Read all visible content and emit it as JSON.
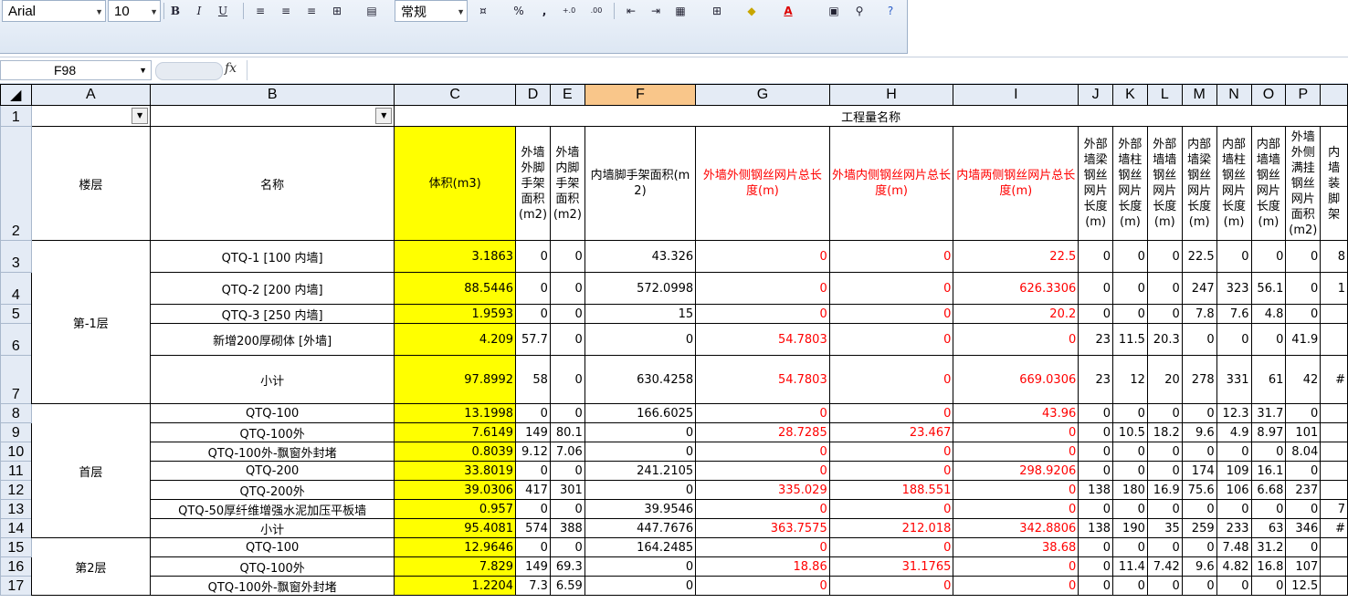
{
  "toolbar": {
    "font_name": "Arial",
    "font_size": "10",
    "bold_label": "B",
    "italic_label": "I",
    "underline_label": "U",
    "number_format": "常规",
    "percent_label": "%",
    "comma_label": ",",
    "inc_decimal_label": "+.0 .00",
    "dec_decimal_label": ".00 →.0"
  },
  "formula_bar": {
    "name_box": "F98",
    "fx_label": "fx",
    "content": ""
  },
  "columns": [
    "A",
    "B",
    "C",
    "D",
    "E",
    "F",
    "G",
    "H",
    "I",
    "J",
    "K",
    "L",
    "M",
    "N",
    "O",
    "P",
    ""
  ],
  "row_numbers": [
    "1",
    "2",
    "3",
    "4",
    "5",
    "6",
    "7",
    "8",
    "9",
    "10",
    "11",
    "12",
    "13",
    "14",
    "15",
    "16",
    "17"
  ],
  "header": {
    "floor": "楼层",
    "name": "名称",
    "group_title": "工程量名称",
    "c": "体积(m3)",
    "d": "外墙外脚手架面积(m2)",
    "e": "外墙内脚手架面积(m2)",
    "f": "内墙脚手架面积(m2)",
    "g": "外墙外侧钢丝网片总长度(m)",
    "h": "外墙内侧钢丝网片总长度(m)",
    "i": "内墙两侧钢丝网片总长度(m)",
    "j": "外部墙梁钢丝网片长度(m)",
    "k": "外部墙柱钢丝网片长度(m)",
    "l": "外部墙墙钢丝网片长度(m)",
    "m": "内部墙梁钢丝网片长度(m)",
    "n": "内部墙柱钢丝网片长度(m)",
    "o": "内部墙墙钢丝网片长度(m)",
    "p": "外墙外侧满挂钢丝网片面积(m2)",
    "q": "内墙装脚架"
  },
  "groups": [
    {
      "floor": "第-1层"
    },
    {
      "floor": "首层"
    },
    {
      "floor": "第2层"
    }
  ],
  "rows": [
    {
      "name": "QTQ-1 [100 内墙]",
      "c": "3.1863",
      "d": "0",
      "e": "0",
      "f": "43.326",
      "g": "0",
      "h": "0",
      "i": "22.5",
      "j": "0",
      "k": "0",
      "l": "0",
      "m": "22.5",
      "n": "0",
      "o": "0",
      "p": "0",
      "q": "8"
    },
    {
      "name": "QTQ-2 [200 内墙]",
      "c": "88.5446",
      "d": "0",
      "e": "0",
      "f": "572.0998",
      "g": "0",
      "h": "0",
      "i": "626.3306",
      "j": "0",
      "k": "0",
      "l": "0",
      "m": "247",
      "n": "323",
      "o": "56.1",
      "p": "0",
      "q": "1"
    },
    {
      "name": "QTQ-3 [250 内墙]",
      "c": "1.9593",
      "d": "0",
      "e": "0",
      "f": "15",
      "g": "0",
      "h": "0",
      "i": "20.2",
      "j": "0",
      "k": "0",
      "l": "0",
      "m": "7.8",
      "n": "7.6",
      "o": "4.8",
      "p": "0",
      "q": ""
    },
    {
      "name": "新增200厚砌体 [外墙]",
      "c": "4.209",
      "d": "57.7",
      "e": "0",
      "f": "0",
      "g": "54.7803",
      "h": "0",
      "i": "0",
      "j": "23",
      "k": "11.5",
      "l": "20.3",
      "m": "0",
      "n": "0",
      "o": "0",
      "p": "41.9",
      "q": ""
    },
    {
      "name": "小计",
      "c": "97.8992",
      "d": "58",
      "e": "0",
      "f": "630.4258",
      "g": "54.7803",
      "h": "0",
      "i": "669.0306",
      "j": "23",
      "k": "12",
      "l": "20",
      "m": "278",
      "n": "331",
      "o": "61",
      "p": "42",
      "q": "#"
    },
    {
      "name": "QTQ-100",
      "c": "13.1998",
      "d": "0",
      "e": "0",
      "f": "166.6025",
      "g": "0",
      "h": "0",
      "i": "43.96",
      "j": "0",
      "k": "0",
      "l": "0",
      "m": "0",
      "n": "12.3",
      "o": "31.7",
      "p": "0",
      "q": ""
    },
    {
      "name": "QTQ-100外",
      "c": "7.6149",
      "d": "149",
      "e": "80.1",
      "f": "0",
      "g": "28.7285",
      "h": "23.467",
      "i": "0",
      "j": "0",
      "k": "10.5",
      "l": "18.2",
      "m": "9.6",
      "n": "4.9",
      "o": "8.97",
      "p": "101",
      "q": ""
    },
    {
      "name": "QTQ-100外-飘窗外封堵",
      "c": "0.8039",
      "d": "9.12",
      "e": "7.06",
      "f": "0",
      "g": "0",
      "h": "0",
      "i": "0",
      "j": "0",
      "k": "0",
      "l": "0",
      "m": "0",
      "n": "0",
      "o": "0",
      "p": "8.04",
      "q": ""
    },
    {
      "name": "QTQ-200",
      "c": "33.8019",
      "d": "0",
      "e": "0",
      "f": "241.2105",
      "g": "0",
      "h": "0",
      "i": "298.9206",
      "j": "0",
      "k": "0",
      "l": "0",
      "m": "174",
      "n": "109",
      "o": "16.1",
      "p": "0",
      "q": ""
    },
    {
      "name": "QTQ-200外",
      "c": "39.0306",
      "d": "417",
      "e": "301",
      "f": "0",
      "g": "335.029",
      "h": "188.551",
      "i": "0",
      "j": "138",
      "k": "180",
      "l": "16.9",
      "m": "75.6",
      "n": "106",
      "o": "6.68",
      "p": "237",
      "q": ""
    },
    {
      "name": "QTQ-50厚纤维增强水泥加压平板墙",
      "c": "0.957",
      "d": "0",
      "e": "0",
      "f": "39.9546",
      "g": "0",
      "h": "0",
      "i": "0",
      "j": "0",
      "k": "0",
      "l": "0",
      "m": "0",
      "n": "0",
      "o": "0",
      "p": "0",
      "q": "7"
    },
    {
      "name": "小计",
      "c": "95.4081",
      "d": "574",
      "e": "388",
      "f": "447.7676",
      "g": "363.7575",
      "h": "212.018",
      "i": "342.8806",
      "j": "138",
      "k": "190",
      "l": "35",
      "m": "259",
      "n": "233",
      "o": "63",
      "p": "346",
      "q": "#"
    },
    {
      "name": "QTQ-100",
      "c": "12.9646",
      "d": "0",
      "e": "0",
      "f": "164.2485",
      "g": "0",
      "h": "0",
      "i": "38.68",
      "j": "0",
      "k": "0",
      "l": "0",
      "m": "0",
      "n": "7.48",
      "o": "31.2",
      "p": "0",
      "q": ""
    },
    {
      "name": "QTQ-100外",
      "c": "7.829",
      "d": "149",
      "e": "69.3",
      "f": "0",
      "g": "18.86",
      "h": "31.1765",
      "i": "0",
      "j": "0",
      "k": "11.4",
      "l": "7.42",
      "m": "9.6",
      "n": "4.82",
      "o": "16.8",
      "p": "107",
      "q": ""
    },
    {
      "name": "QTQ-100外-飘窗外封堵",
      "c": "1.2204",
      "d": "7.3",
      "e": "6.59",
      "f": "0",
      "g": "0",
      "h": "0",
      "i": "0",
      "j": "0",
      "k": "0",
      "l": "0",
      "m": "0",
      "n": "0",
      "o": "0",
      "p": "12.5",
      "q": ""
    }
  ]
}
